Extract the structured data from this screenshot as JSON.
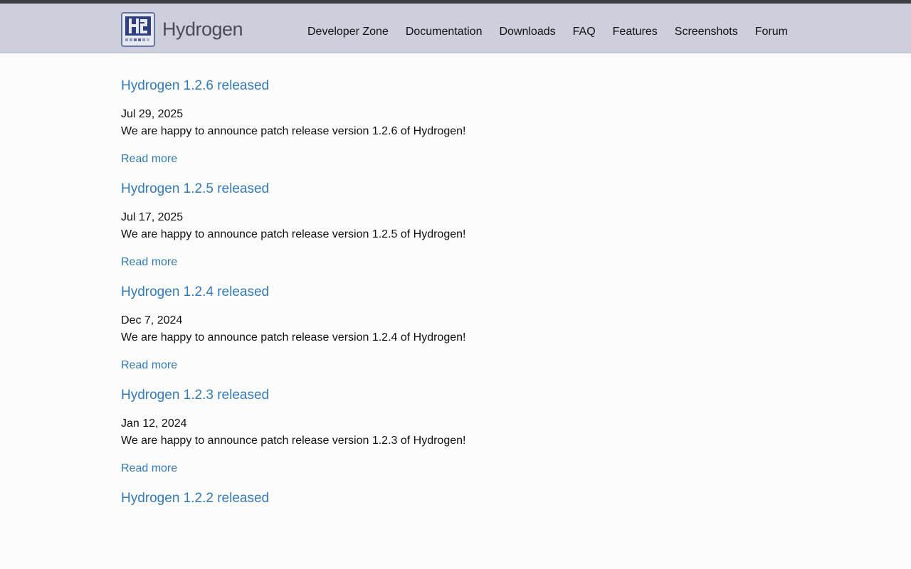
{
  "colors": {
    "topbar": "#3d3e42",
    "header_bg": "#cdd0dc",
    "link": "#337ab7",
    "logo_blue": "#2f3f7f"
  },
  "header": {
    "logo_text": "Hydrogen",
    "logo_icon": "h2-logo-icon",
    "nav": [
      {
        "label": "Developer Zone"
      },
      {
        "label": "Documentation"
      },
      {
        "label": "Downloads"
      },
      {
        "label": "FAQ"
      },
      {
        "label": "Features"
      },
      {
        "label": "Screenshots"
      },
      {
        "label": "Forum"
      }
    ]
  },
  "posts": [
    {
      "title": "Hydrogen 1.2.6 released",
      "date": "Jul 29, 2025",
      "summary": "We are happy to announce patch release version 1.2.6 of Hydrogen!",
      "more": "Read more"
    },
    {
      "title": "Hydrogen 1.2.5 released",
      "date": "Jul 17, 2025",
      "summary": "We are happy to announce patch release version 1.2.5 of Hydrogen!",
      "more": "Read more"
    },
    {
      "title": "Hydrogen 1.2.4 released",
      "date": "Dec 7, 2024",
      "summary": "We are happy to announce patch release version 1.2.4 of Hydrogen!",
      "more": "Read more"
    },
    {
      "title": "Hydrogen 1.2.3 released",
      "date": "Jan 12, 2024",
      "summary": "We are happy to announce patch release version 1.2.3 of Hydrogen!",
      "more": "Read more"
    },
    {
      "title": "Hydrogen 1.2.2 released"
    }
  ]
}
